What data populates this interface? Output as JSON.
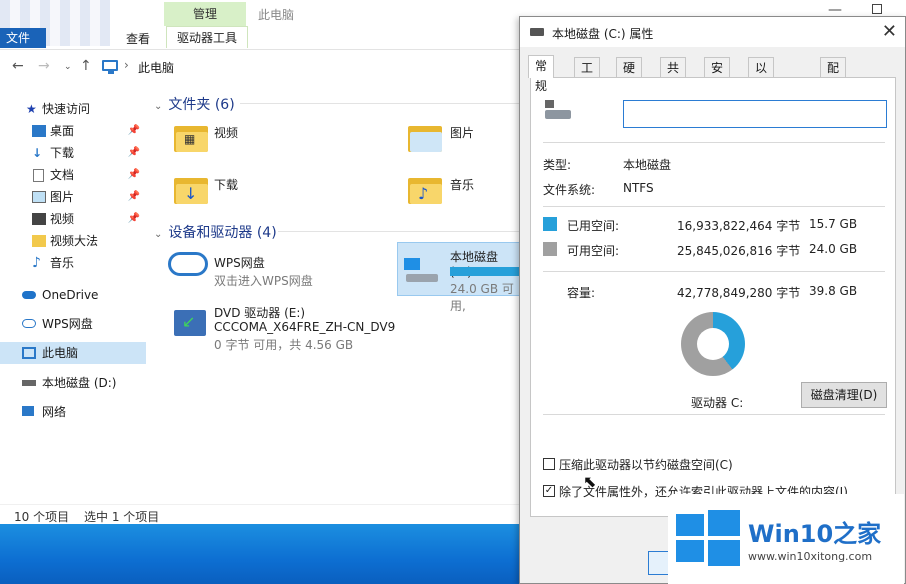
{
  "explorer": {
    "ribbon": {
      "file_tab": "文件",
      "view_tab": "查看",
      "manage_header": "管理",
      "drive_tools_tab": "驱动器工具",
      "window_title": "此电脑"
    },
    "address": {
      "path": "此电脑"
    },
    "sidebar": {
      "quick_access": "快速访问",
      "items": [
        {
          "label": "桌面",
          "icon": "desktop-icon",
          "pinned": true
        },
        {
          "label": "下载",
          "icon": "download-arrow-icon",
          "pinned": true
        },
        {
          "label": "文档",
          "icon": "document-icon",
          "pinned": true
        },
        {
          "label": "图片",
          "icon": "picture-icon",
          "pinned": true
        },
        {
          "label": "视频",
          "icon": "video-icon",
          "pinned": true
        },
        {
          "label": "视频大法",
          "icon": "folder-icon",
          "pinned": false
        },
        {
          "label": "音乐",
          "icon": "music-note-icon",
          "pinned": false
        }
      ],
      "onedrive": "OneDrive",
      "wps": "WPS网盘",
      "this_pc": "此电脑",
      "local_d": "本地磁盘 (D:)",
      "network": "网络"
    },
    "folders_group": "文件夹 (6)",
    "folders": [
      {
        "label": "视频"
      },
      {
        "label": "图片"
      },
      {
        "label": "下载"
      },
      {
        "label": "音乐"
      }
    ],
    "devices_group": "设备和驱动器 (4)",
    "devices": {
      "wps_name": "WPS网盘",
      "wps_sub": "双击进入WPS网盘",
      "c_name": "本地磁盘 (C:)",
      "c_sub": "24.0 GB 可用,",
      "c_used_fraction": 0.4,
      "dvd_name": "DVD 驱动器 (E:)",
      "dvd_label": "CCCOMA_X64FRE_ZH-CN_DV9",
      "dvd_sub": "0 字节 可用，共 4.56 GB"
    },
    "status": {
      "count": "10 个项目",
      "selected": "选中 1 个项目"
    }
  },
  "dialog": {
    "title": "本地磁盘 (C:) 属性",
    "tabs": [
      "常规",
      "工具",
      "硬件",
      "共享",
      "安全",
      "以前的版本",
      "配额"
    ],
    "active_tab": "常规",
    "name_value": "",
    "type_label": "类型:",
    "type_value": "本地磁盘",
    "fs_label": "文件系统:",
    "fs_value": "NTFS",
    "used_label": "已用空间:",
    "used_bytes": "16,933,822,464 字节",
    "used_gb": "15.7 GB",
    "free_label": "可用空间:",
    "free_bytes": "25,845,026,816 字节",
    "free_gb": "24.0 GB",
    "cap_label": "容量:",
    "cap_bytes": "42,778,849,280 字节",
    "cap_gb": "39.8 GB",
    "drive_label": "驱动器 C:",
    "cleanup_button": "磁盘清理(D)",
    "compress_label": "压缩此驱动器以节约磁盘空间(C)",
    "index_label": "除了文件属性外，还允许索引此驱动器上文件的内容(I)",
    "used_fraction": 0.396,
    "colors": {
      "used": "#26a0da",
      "free": "#a0a0a0"
    }
  },
  "watermark": {
    "brand": "Win10之家",
    "url": "www.win10xitong.com"
  }
}
